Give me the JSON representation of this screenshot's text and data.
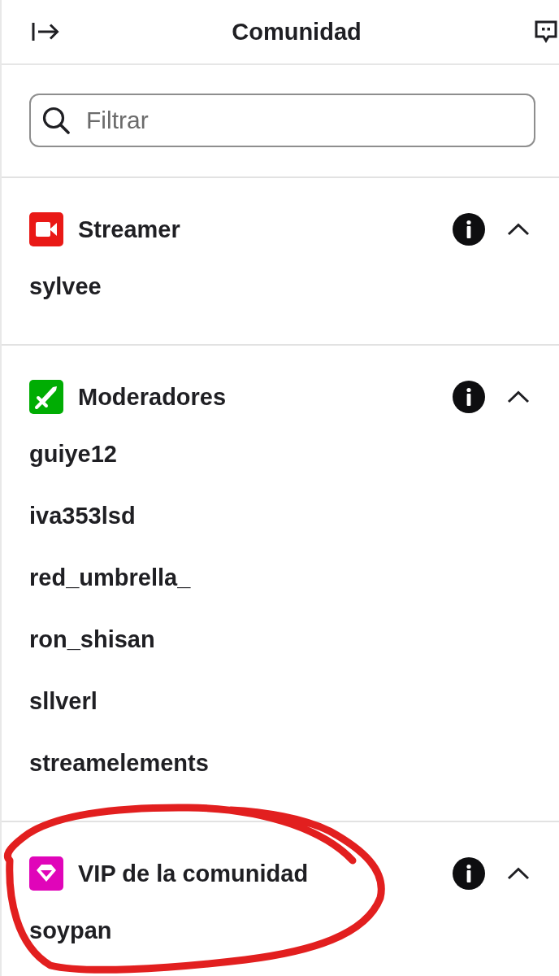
{
  "header": {
    "title": "Comunidad"
  },
  "search": {
    "placeholder": "Filtrar"
  },
  "sections": [
    {
      "kind": "streamer",
      "title": "Streamer",
      "color": "#e91916",
      "expanded": true,
      "circled": false,
      "members": [
        "sylvee"
      ]
    },
    {
      "kind": "moderator",
      "title": "Moderadores",
      "color": "#00ad03",
      "expanded": true,
      "circled": false,
      "members": [
        "guiye12",
        "iva353lsd",
        "red_umbrella_",
        "ron_shisan",
        "sllverl",
        "streamelements"
      ]
    },
    {
      "kind": "vip",
      "title": "VIP de la comunidad",
      "color": "#e005b9",
      "expanded": true,
      "circled": true,
      "members": [
        "soypan"
      ]
    }
  ]
}
